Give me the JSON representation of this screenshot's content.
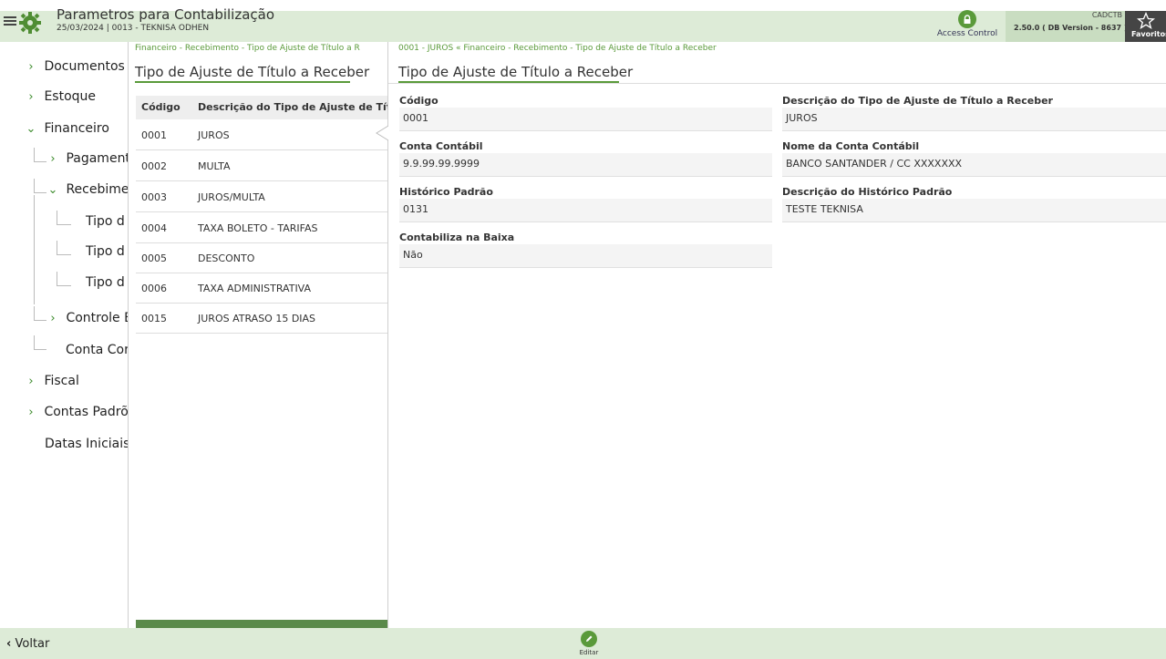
{
  "header": {
    "title": "Parametros para Contabilização",
    "subtitle": "25/03/2024 | 0013 - TEKNISA ODHEN",
    "access_control": "Access Control",
    "program_code": "CADCTB",
    "version": "2.50.0 ( DB Version - 8637 )",
    "favorites": "Favoritos"
  },
  "sidebar": {
    "items": [
      {
        "label": "Documentos",
        "chevron": "›"
      },
      {
        "label": "Estoque",
        "chevron": "›"
      },
      {
        "label": "Financeiro",
        "chevron": "⌄"
      },
      {
        "label": "Pagament",
        "chevron": "›"
      },
      {
        "label": "Recebime",
        "chevron": "⌄"
      },
      {
        "label": "Tipo d"
      },
      {
        "label": "Tipo d"
      },
      {
        "label": "Tipo d"
      },
      {
        "label": "Controle E",
        "chevron": "›"
      },
      {
        "label": "Conta Cor"
      },
      {
        "label": "Fiscal",
        "chevron": "›"
      },
      {
        "label": "Contas Padrõ",
        "chevron": "›"
      },
      {
        "label": "Datas Iniciais"
      }
    ]
  },
  "list": {
    "breadcrumb": "Financeiro - Recebimento - Tipo de Ajuste de Título a R",
    "title": "Tipo de Ajuste de Título a Receber",
    "columns": [
      "Código",
      "Descrição do Tipo de Ajuste de Títul"
    ],
    "rows": [
      {
        "code": "0001",
        "desc": "JUROS"
      },
      {
        "code": "0002",
        "desc": "MULTA"
      },
      {
        "code": "0003",
        "desc": "JUROS/MULTA"
      },
      {
        "code": "0004",
        "desc": "TAXA BOLETO - TARIFAS"
      },
      {
        "code": "0005",
        "desc": "DESCONTO"
      },
      {
        "code": "0006",
        "desc": "TAXA ADMINISTRATIVA"
      },
      {
        "code": "0015",
        "desc": "JUROS ATRASO 15 DIAS"
      }
    ]
  },
  "detail": {
    "breadcrumb": "0001 - JUROS « Financeiro - Recebimento - Tipo de Ajuste de Título a Receber",
    "title": "Tipo de Ajuste de Título a Receber",
    "fields": {
      "codigo": {
        "label": "Código",
        "value": "0001"
      },
      "descricao": {
        "label": "Descrição do Tipo de Ajuste de Título a Receber",
        "value": "JUROS"
      },
      "conta": {
        "label": "Conta Contábil",
        "value": "9.9.99.99.9999"
      },
      "nome_conta": {
        "label": "Nome da Conta Contábil",
        "value": "BANCO SANTANDER / CC XXXXXXX"
      },
      "historico": {
        "label": "Histórico Padrão",
        "value": "0131"
      },
      "desc_historico": {
        "label": "Descrição do Histórico Padrão",
        "value": "TESTE TEKNISA"
      },
      "contabiliza": {
        "label": "Contabiliza na Baixa",
        "value": "Não"
      }
    }
  },
  "footer": {
    "back": "Voltar",
    "back_icon": "‹",
    "edit": "Editar"
  },
  "colors": {
    "accent_green": "#5a9a3a",
    "bar_green": "#ddebd7"
  }
}
